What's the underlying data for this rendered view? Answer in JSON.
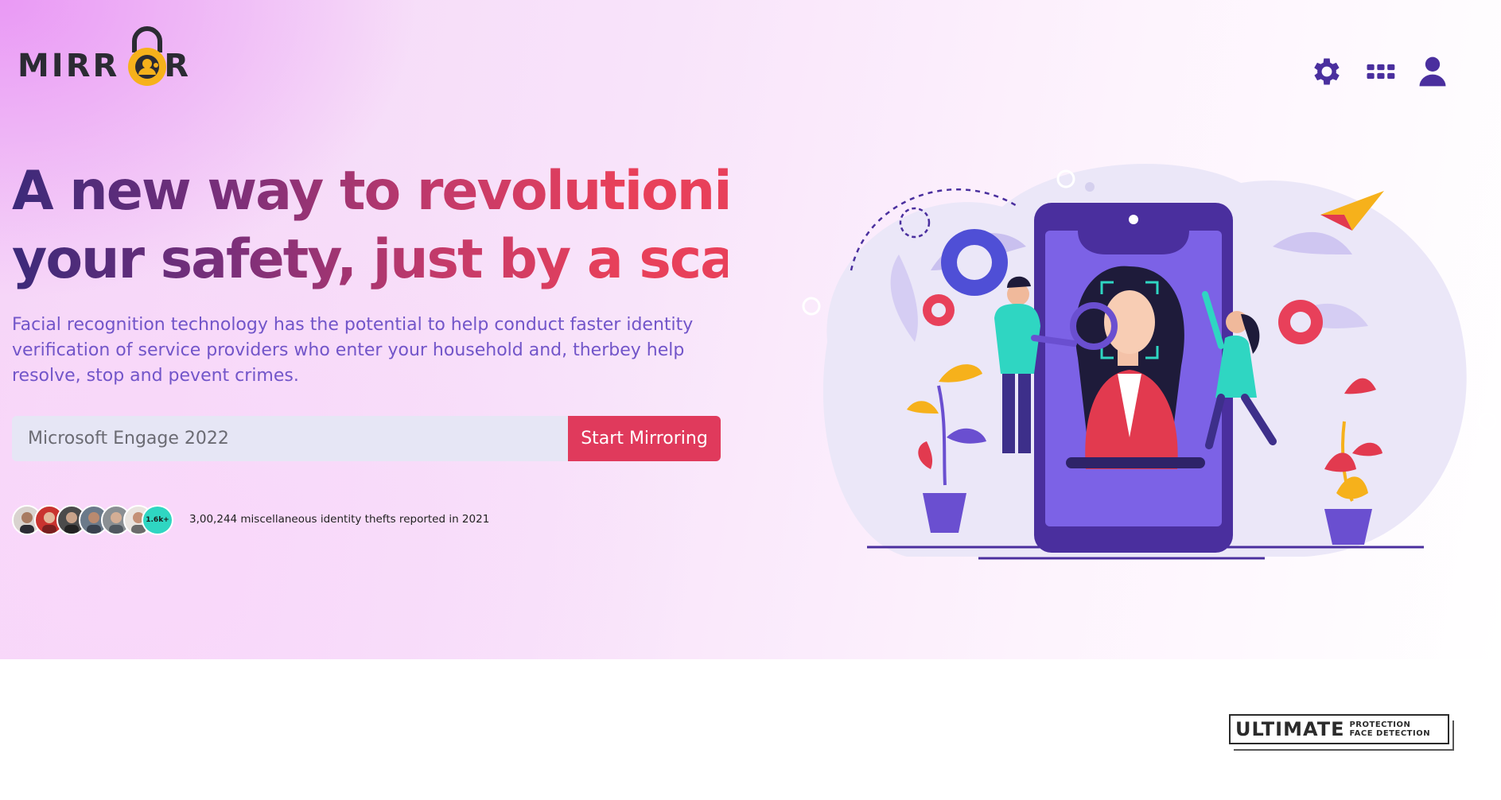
{
  "logo": {
    "text_left": "MIRR",
    "text_right": "R",
    "icon": "padlock-icon"
  },
  "header": {
    "icons": [
      {
        "name": "settings-gear-icon",
        "color": "#4a2f9e"
      },
      {
        "name": "apps-grid-icon",
        "color": "#4a2f9e"
      },
      {
        "name": "user-profile-icon",
        "color": "#4a2f9e"
      }
    ]
  },
  "hero": {
    "headline_line1": "A new way to revolutionise",
    "headline_line2": "your safety, just by a scan",
    "description": "Facial recognition technology has the potential to help conduct faster identity verification of service providers who enter your household and, therbey help resolve, stop and pevent crimes.",
    "search": {
      "placeholder": "Microsoft Engage 2022",
      "value": ""
    },
    "cta_label": "Start Mirroring",
    "avatar_count": "1.6k+",
    "stat_text": "3,00,244 miscellaneous identity thefts reported in 2021"
  },
  "badge": {
    "main": "ULTIMATE",
    "sub_line1": "PROTECTION",
    "sub_line2": "FACE DETECTION"
  },
  "colors": {
    "primary": "#4a2f9e",
    "accent": "#e03a5c",
    "text_purple": "#7255c9",
    "teal": "#2fd6c2"
  }
}
